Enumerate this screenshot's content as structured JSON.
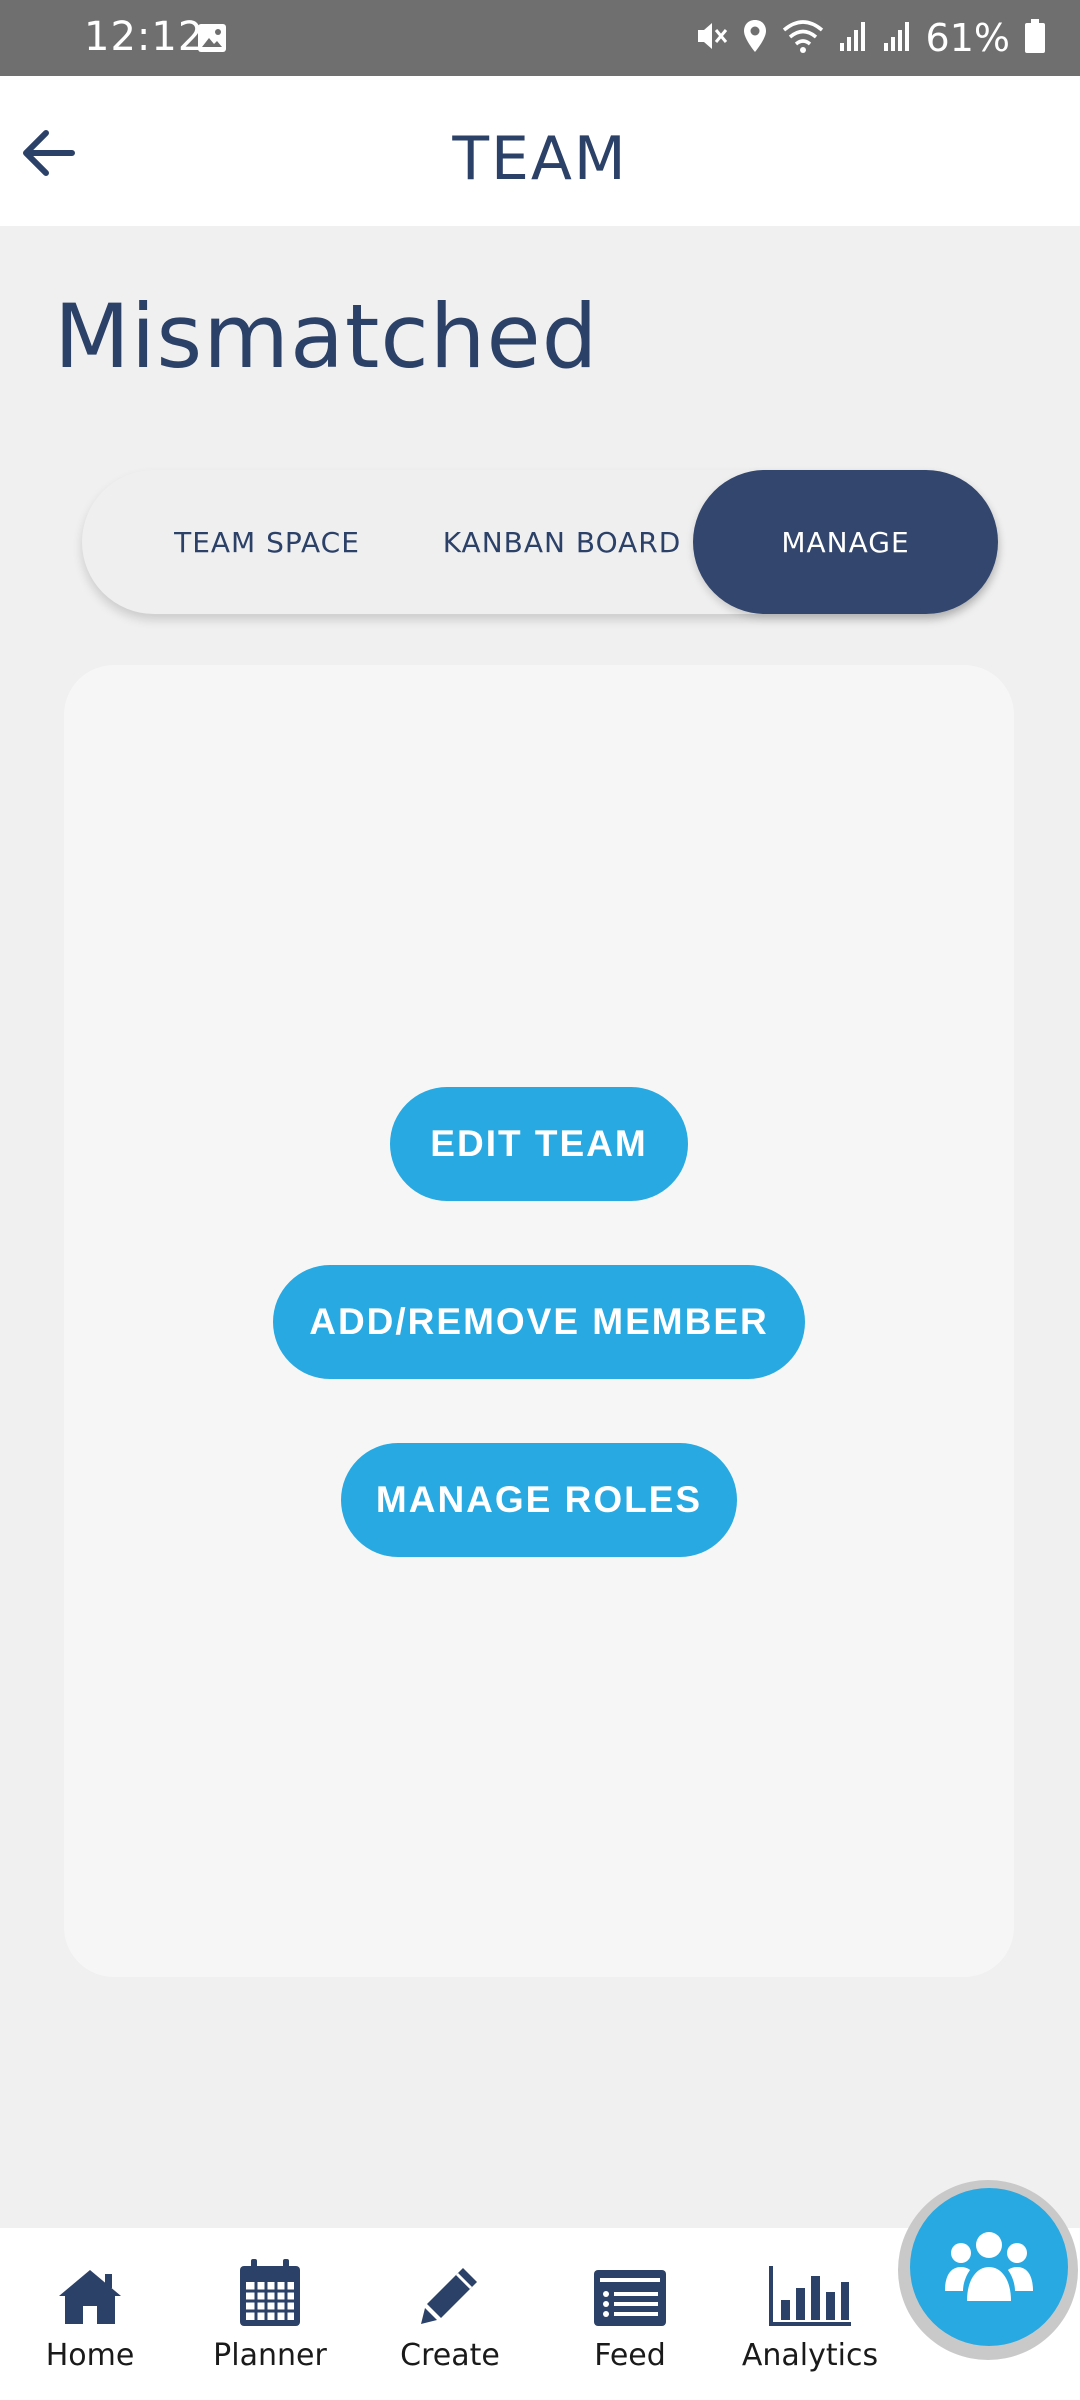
{
  "status_bar": {
    "time": "12:12",
    "battery": "61%"
  },
  "app_bar": {
    "title": "TEAM"
  },
  "team": {
    "name": "Mismatched"
  },
  "tabs": [
    {
      "label": "TEAM SPACE"
    },
    {
      "label": "KANBAN BOARD"
    },
    {
      "label": "MANAGE",
      "selected": true
    }
  ],
  "manage": {
    "edit_team": "EDIT TEAM",
    "add_remove_member": "ADD/REMOVE MEMBER",
    "manage_roles": "MANAGE ROLES"
  },
  "bottom_nav": [
    {
      "label": "Home",
      "icon": "home-icon"
    },
    {
      "label": "Planner",
      "icon": "calendar-icon"
    },
    {
      "label": "Create",
      "icon": "pencil-icon"
    },
    {
      "label": "Feed",
      "icon": "feed-icon"
    },
    {
      "label": "Analytics",
      "icon": "bar-chart-icon"
    }
  ],
  "colors": {
    "primary": "#2c4168",
    "accent": "#28a9e1",
    "tab_selected": "#33466e"
  }
}
